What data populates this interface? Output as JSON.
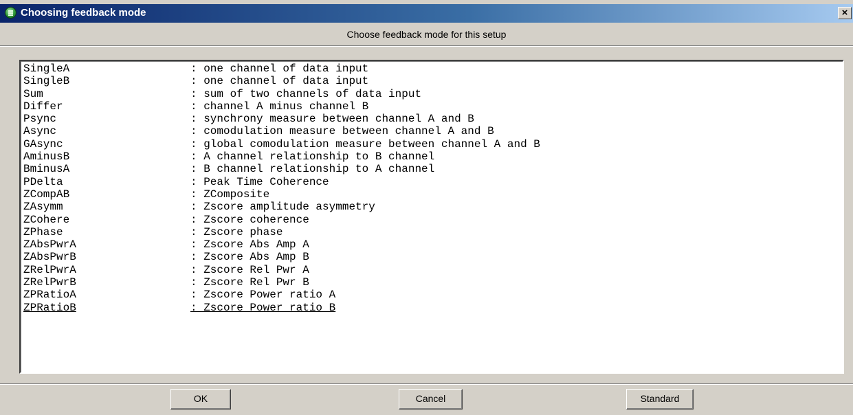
{
  "window": {
    "title": "Choosing feedback mode",
    "close_label": "×"
  },
  "header": {
    "text": "Choose feedback mode for this setup"
  },
  "modes": [
    {
      "name": "SingleA",
      "description": ": one channel of data input"
    },
    {
      "name": "SingleB",
      "description": ": one channel of data input"
    },
    {
      "name": "Sum",
      "description": ": sum of two channels of data input"
    },
    {
      "name": "Differ",
      "description": ": channel A minus channel B"
    },
    {
      "name": "Psync",
      "description": ": synchrony measure between channel A and B"
    },
    {
      "name": "Async",
      "description": ": comodulation measure between channel A and B"
    },
    {
      "name": "GAsync",
      "description": ": global comodulation measure between channel A and B"
    },
    {
      "name": "AminusB",
      "description": ": A channel relationship to B channel"
    },
    {
      "name": "BminusA",
      "description": ": B channel relationship to A channel"
    },
    {
      "name": "PDelta",
      "description": ": Peak Time Coherence"
    },
    {
      "name": "ZCompAB",
      "description": ": ZComposite"
    },
    {
      "name": "ZAsymm",
      "description": ": Zscore amplitude asymmetry"
    },
    {
      "name": "ZCohere",
      "description": ": Zscore coherence"
    },
    {
      "name": "ZPhase",
      "description": ": Zscore phase"
    },
    {
      "name": "ZAbsPwrA",
      "description": ": Zscore Abs Amp A"
    },
    {
      "name": "ZAbsPwrB",
      "description": ": Zscore Abs Amp B"
    },
    {
      "name": "ZRelPwrA",
      "description": ": Zscore Rel Pwr A"
    },
    {
      "name": "ZRelPwrB",
      "description": ": Zscore Rel Pwr B"
    },
    {
      "name": "ZPRatioA",
      "description": ": Zscore Power ratio A"
    },
    {
      "name": "ZPRatioB",
      "description": ": Zscore Power ratio B"
    }
  ],
  "buttons": {
    "ok": "OK",
    "cancel": "Cancel",
    "standard": "Standard"
  },
  "colors": {
    "title_bar_start": "#0a246a",
    "title_bar_end": "#a6caf0",
    "dialog_face": "#d4d0c8",
    "list_background": "#ffffff"
  },
  "icons": {
    "app": "app-icon",
    "close": "close-icon"
  }
}
